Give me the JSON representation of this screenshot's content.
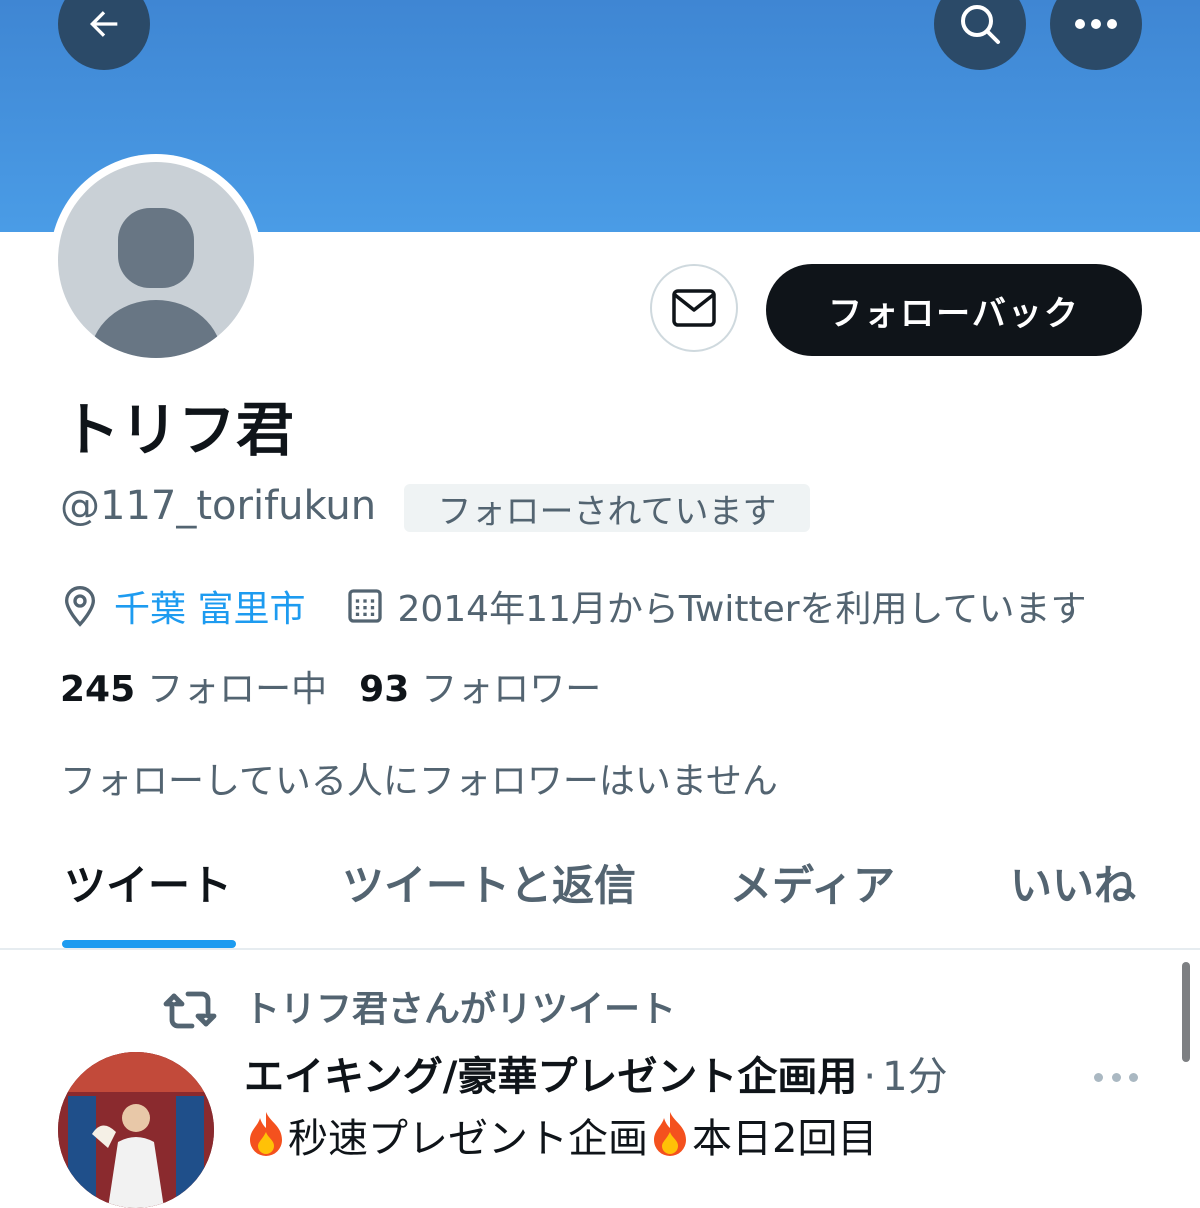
{
  "header": {
    "back_icon": "arrow-left-icon",
    "search_icon": "search-icon",
    "more_icon": "more-horizontal-icon",
    "banner_color": "#4a9ce6"
  },
  "profile": {
    "display_name": "トリフ君",
    "handle": "@117_torifukun",
    "follows_you_badge": "フォローされています",
    "location": "千葉 富里市",
    "joined": "2014年11月からTwitterを利用しています",
    "following_count": "245",
    "following_label": "フォロー中",
    "followers_count": "93",
    "followers_label": "フォロワー",
    "mutual_note": "フォローしている人にフォロワーはいません"
  },
  "actions": {
    "message_icon": "mail-icon",
    "follow_back_label": "フォローバック"
  },
  "tabs": [
    {
      "label": "ツイート",
      "active": true
    },
    {
      "label": "ツイートと返信",
      "active": false
    },
    {
      "label": "メディア",
      "active": false
    },
    {
      "label": "いいね",
      "active": false
    }
  ],
  "timeline": {
    "retweet_label": "トリフ君さんがリツイート",
    "tweet": {
      "author": "エイキング/豪華プレゼント企画用",
      "separator": "·",
      "time": "1分",
      "text_part1": "秒速プレゼント企画",
      "text_part2": "本日2回目"
    }
  },
  "colors": {
    "accent": "#1d9bf0",
    "primary_button": "#0f1419",
    "secondary_text": "#536471"
  }
}
